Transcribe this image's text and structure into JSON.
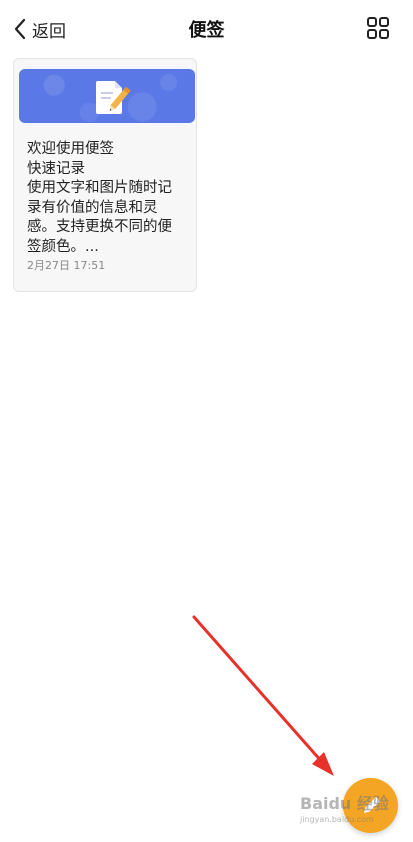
{
  "header": {
    "back_label": "返回",
    "title": "便签"
  },
  "note": {
    "lines": [
      "欢迎使用便签",
      "快速记录",
      "使用文字和图片随时记",
      "录有价值的信息和灵",
      "感。支持更换不同的便",
      "签颜色。..."
    ],
    "date": "2月27日 17:51",
    "banner_color": "#5b79e6"
  },
  "fab": {
    "icon": "pencil-icon",
    "color": "#f5a524"
  },
  "watermark": {
    "text": "Baidu 经验",
    "sub": "jingyan.baidu.com"
  },
  "colors": {
    "annotation_arrow": "#e8312a"
  }
}
